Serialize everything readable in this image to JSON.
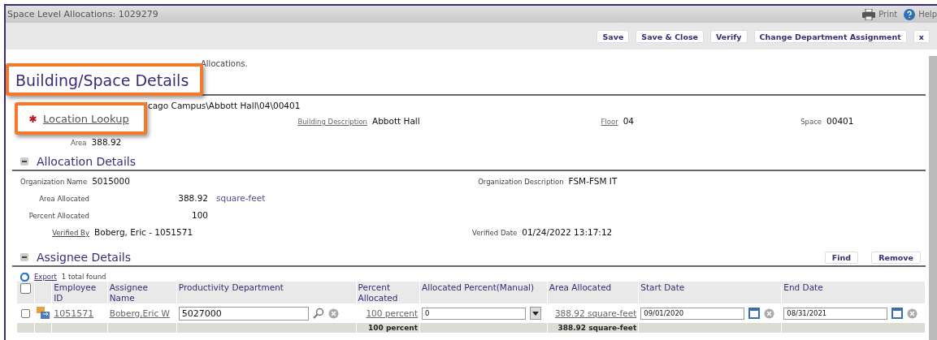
{
  "window": {
    "title": "Space Level Allocations: 1029279"
  },
  "header_links": [
    {
      "kind": "print",
      "label": "Print"
    },
    {
      "kind": "help",
      "label": "Help"
    }
  ],
  "toolbar": {
    "buttons": [
      "Save",
      "Save & Close",
      "Verify",
      "Change Department Assignment",
      "x"
    ]
  },
  "intro_text": "Allocations.",
  "callouts": [
    {
      "kind": "heading",
      "text": "Building/Space Details"
    },
    {
      "kind": "link",
      "text": "Location Lookup",
      "required": true
    }
  ],
  "building_space": {
    "location_value": "icago Campus\\Abbott Hall\\04\\00401",
    "fields": [
      {
        "label": "Building Description",
        "value": "Abbott Hall",
        "link": true
      },
      {
        "label": "Floor",
        "value": "04",
        "link": true
      },
      {
        "label": "Space",
        "value": "00401",
        "link": false
      }
    ],
    "area": {
      "label": "Area",
      "value": "388.92"
    }
  },
  "allocation": {
    "title": "Allocation Details",
    "expanded": true,
    "organization_name": {
      "label": "Organization Name",
      "value": "5015000"
    },
    "organization_description": {
      "label": "Organization Description",
      "value": "FSM-FSM IT"
    },
    "area_allocated": {
      "label": "Area Allocated",
      "value": "388.92",
      "unit": "square-feet"
    },
    "percent_allocated": {
      "label": "Percent Allocated",
      "value": "100"
    },
    "verified_by": {
      "label": "Verified By",
      "value": "Boberg, Eric - 1051571"
    },
    "verified_date": {
      "label": "Verified Date",
      "value": "01/24/2022 13:17:12"
    }
  },
  "assignees": {
    "title": "Assignee Details",
    "expanded": true,
    "buttons": [
      "Find",
      "Remove"
    ],
    "export": "Export",
    "count": "1 total found",
    "all_checked": false,
    "columns": [
      "Employee ID",
      "Assignee Name",
      "Productivity Department",
      "Percent Allocated",
      "Allocated Percent(Manual)",
      "Area Allocated",
      "Start Date",
      "End Date"
    ],
    "rows": [
      {
        "checked": false,
        "employee_id": "1051571",
        "name": "Boberg,Eric W",
        "department": "5027000",
        "percent": "100 percent",
        "manual": "0",
        "area": "388.92 square-feet",
        "start_date": "09/01/2020",
        "end_date": "08/31/2021"
      }
    ],
    "totals": {
      "percent": "100 percent",
      "area": "388.92 square-feet"
    }
  }
}
